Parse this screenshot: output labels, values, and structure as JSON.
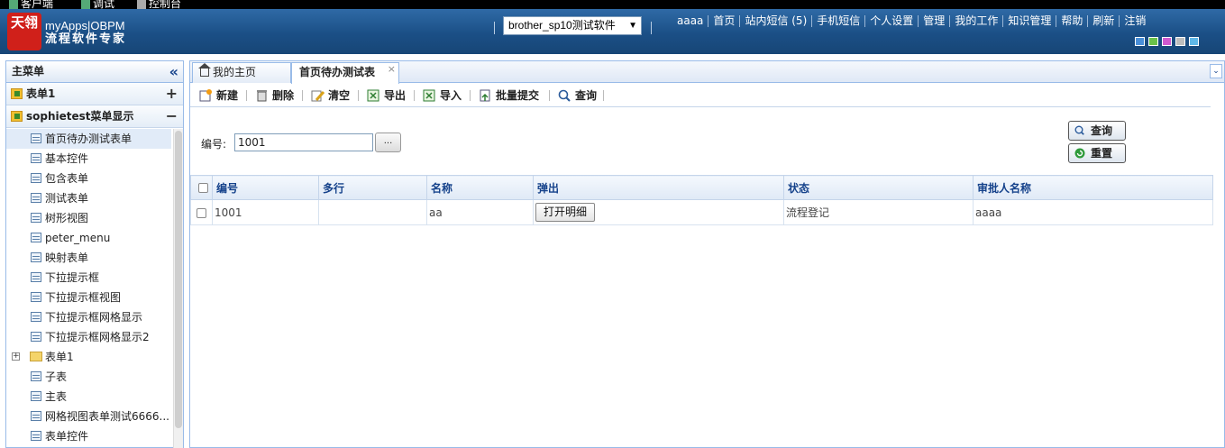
{
  "topstrip": {
    "items": [
      "客户端",
      "调试",
      "控制台"
    ]
  },
  "header": {
    "logo_text": "天翎",
    "brand_line1": "myApps|OBPM",
    "brand_line2": "流程软件专家",
    "app_select": "brother_sp10测试软件",
    "nav": [
      "aaaa",
      "首页",
      "站内短信 (5)",
      "手机短信",
      "个人设置",
      "管理",
      "我的工作",
      "知识管理",
      "帮助",
      "刷新",
      "注销"
    ],
    "theme_colors": [
      "#4a8fd8",
      "#6ac24a",
      "#d05ad0",
      "#bdbdbd",
      "#5fb8e8"
    ]
  },
  "sidebar": {
    "title": "主菜单",
    "collapse_icon": "«",
    "groups": [
      {
        "label": "表单1",
        "toggle": "+"
      },
      {
        "label": "sophietest菜单显示",
        "toggle": "−"
      }
    ],
    "items": [
      {
        "label": "首页待办测试表单",
        "type": "form",
        "active": true
      },
      {
        "label": "基本控件",
        "type": "form"
      },
      {
        "label": "包含表单",
        "type": "form"
      },
      {
        "label": "测试表单",
        "type": "form"
      },
      {
        "label": "树形视图",
        "type": "form"
      },
      {
        "label": "peter_menu",
        "type": "form"
      },
      {
        "label": "映射表单",
        "type": "form"
      },
      {
        "label": "下拉提示框",
        "type": "form"
      },
      {
        "label": "下拉提示框视图",
        "type": "form"
      },
      {
        "label": "下拉提示框网格显示",
        "type": "form"
      },
      {
        "label": "下拉提示框网格显示2",
        "type": "form"
      },
      {
        "label": "表单1",
        "type": "folder"
      },
      {
        "label": "子表",
        "type": "form"
      },
      {
        "label": "主表",
        "type": "form"
      },
      {
        "label": "网格视图表单测试6666...",
        "type": "form"
      },
      {
        "label": "表单控件",
        "type": "form"
      }
    ]
  },
  "tabs": [
    {
      "label": "我的主页",
      "icon": "home-icon"
    },
    {
      "label": "首页待办测试表",
      "active": true,
      "close": "×"
    }
  ],
  "toolbar": {
    "buttons": [
      {
        "label": "新建",
        "icon": "new-icon"
      },
      {
        "label": "删除",
        "icon": "delete-icon"
      },
      {
        "label": "清空",
        "icon": "clear-icon"
      },
      {
        "label": "导出",
        "icon": "export-icon"
      },
      {
        "label": "导入",
        "icon": "import-icon"
      },
      {
        "label": "批量提交",
        "icon": "batch-submit-icon"
      },
      {
        "label": "查询",
        "icon": "search-icon"
      }
    ]
  },
  "search": {
    "field_label": "编号:",
    "field_value": "1001",
    "dots_label": "...",
    "query_label": "查询",
    "reset_label": "重置"
  },
  "grid": {
    "columns": [
      "编号",
      "多行",
      "名称",
      "弹出",
      "状态",
      "审批人名称"
    ],
    "rows": [
      {
        "cells": [
          "1001",
          "",
          "aa",
          "打开明细",
          "流程登记",
          "aaaa"
        ]
      }
    ]
  }
}
